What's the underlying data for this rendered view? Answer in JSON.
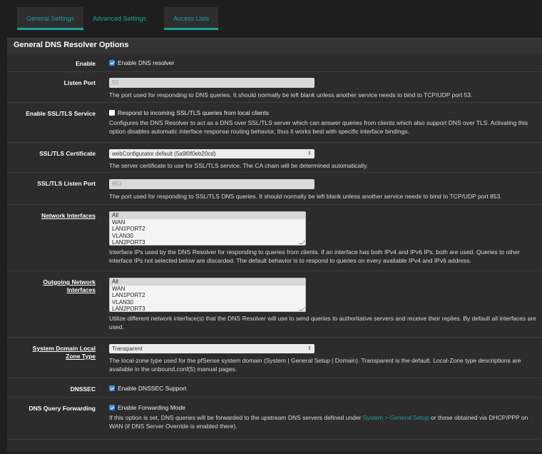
{
  "tabs": [
    {
      "label": "General Settings",
      "active": true
    },
    {
      "label": "Advanced Settings",
      "active": false
    },
    {
      "label": "Access Lists",
      "active": true
    }
  ],
  "panel": {
    "title": "General DNS Resolver Options"
  },
  "rows": {
    "enable": {
      "label": "Enable",
      "checkbox_label": "Enable DNS resolver",
      "checked": true
    },
    "listen_port": {
      "label": "Listen Port",
      "placeholder": "53",
      "help": "The port used for responding to DNS queries. It should normally be left blank unless another service needs to bind to TCP/UDP port 53."
    },
    "ssl": {
      "label": "Enable SSL/TLS Service",
      "checkbox_label": "Respond to incoming SSL/TLS queries from local clients",
      "checked": false,
      "help": "Configures the DNS Resolver to act as a DNS over SSL/TLS server which can answer queries from clients which also support DNS over TLS. Activating this option disables automatic interface response routing behavior, thus it works best with specific interface bindings."
    },
    "cert": {
      "label": "SSL/TLS Certificate",
      "selected": "webConfigurator default (5a9f0f0eb20cd)",
      "help": "The server certificate to use for SSL/TLS service. The CA chain will be determined automatically."
    },
    "ssl_port": {
      "label": "SSL/TLS Listen Port",
      "placeholder": "853",
      "help": "The port used for responding to SSL/TLS DNS queries. It should normally be left blank unless another service needs to bind to TCP/UDP port 853."
    },
    "netif": {
      "label": "Network Interfaces",
      "options": [
        "All",
        "WAN",
        "LAN1PORT2",
        "VLAN30",
        "LAN2PORT3"
      ],
      "help": "Interface IPs used by the DNS Resolver for responding to queries from clients. If an interface has both IPv4 and IPv6 IPs, both are used. Queries to other interface IPs not selected below are discarded. The default behavior is to respond to queries on every available IPv4 and IPv6 address."
    },
    "outif": {
      "label_line1": "Outgoing Network",
      "label_line2": "Interfaces",
      "options": [
        "All",
        "WAN",
        "LAN1PORT2",
        "VLAN30",
        "LAN2PORT3"
      ],
      "help": "Utilize different network interface(s) that the DNS Resolver will use to send queries to authoritative servers and receive their replies. By default all interfaces are used."
    },
    "zone": {
      "label_line1": "System Domain Local",
      "label_line2": "Zone Type",
      "selected": "Transparent",
      "help": "The local-zone type used for the pfSense system domain (System | General Setup | Domain). Transparent is the default. Local-Zone type descriptions are available in the unbound.conf(5) manual pages."
    },
    "dnssec": {
      "label": "DNSSEC",
      "checkbox_label": "Enable DNSSEC Support",
      "checked": true
    },
    "forward": {
      "label": "DNS Query Forwarding",
      "checkbox_label": "Enable Forwarding Mode",
      "checked": true,
      "help_pre": "If this option is set, DNS queries will be forwarded to the upstream DNS servers defined under ",
      "help_link": "System > General Setup",
      "help_post": " or those obtained via DHCP/PPP on WAN (if DNS Server Override is enabled there)."
    }
  }
}
